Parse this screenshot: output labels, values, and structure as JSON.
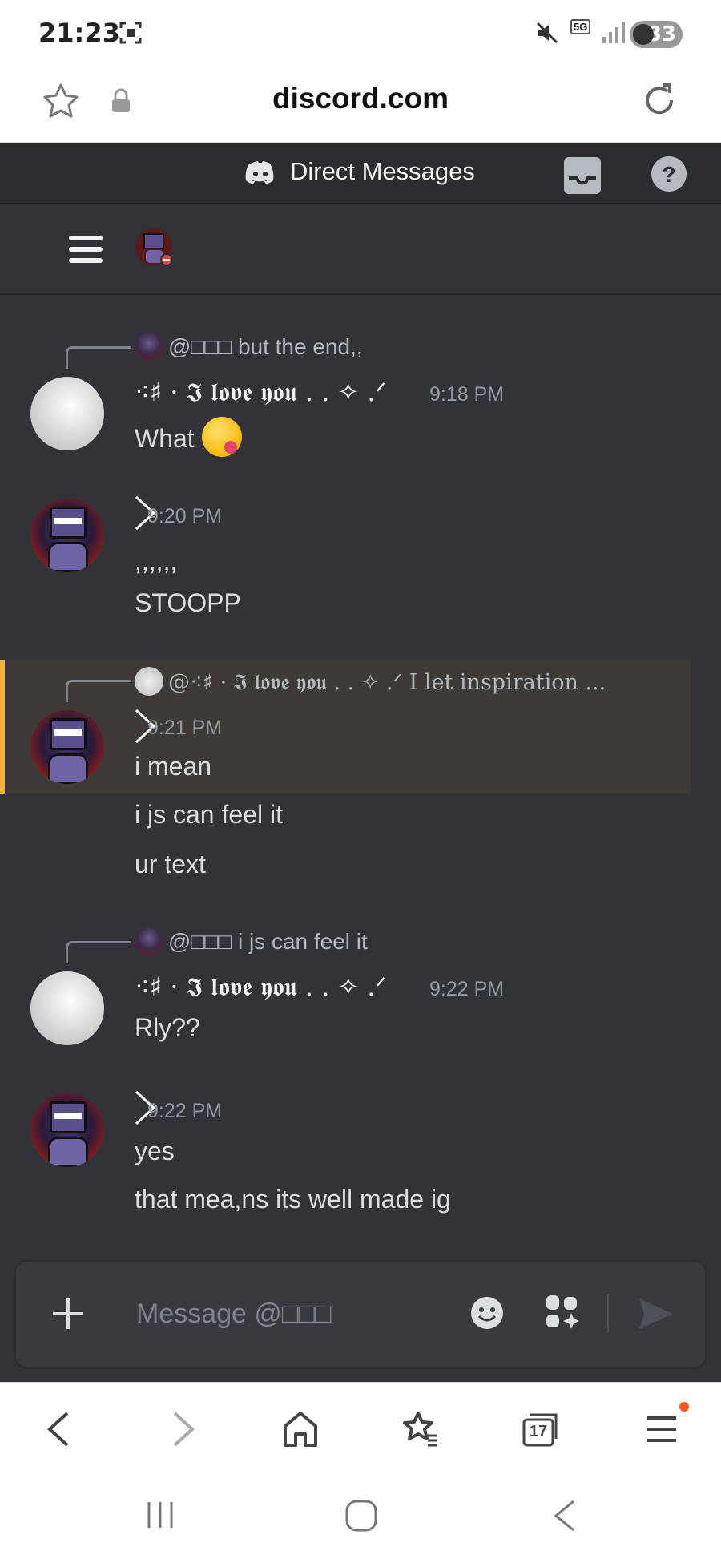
{
  "status": {
    "time": "21:23",
    "net": "5G",
    "battery": "33"
  },
  "browser": {
    "domain": "discord.com",
    "tab_count": "17"
  },
  "header": {
    "title": "Direct Messages"
  },
  "messages": [
    {
      "reply_to": "@□□□ but the end,,",
      "username": "⁖♯ · 𝕴 𝖑𝖔𝖛𝖊 𝖞𝖔𝖚 . . ✧ .ᐟ",
      "time": "9:18 PM",
      "lines": [
        "What"
      ]
    },
    {
      "time": "9:20 PM",
      "lines": [
        ",,,,,,",
        "STOOPP"
      ]
    },
    {
      "reply_to": "@⁖♯ · 𝕴 𝖑𝖔𝖛𝖊 𝖞𝖔𝖚 . . ✧ .ᐟ I let inspiration ...",
      "time": "9:21 PM",
      "lines": [
        "i mean",
        "i js can feel it",
        "ur text"
      ]
    },
    {
      "reply_to": "@□□□ i js can feel it",
      "username": "⁖♯ · 𝕴 𝖑𝖔𝖛𝖊 𝖞𝖔𝖚 . . ✧ .ᐟ",
      "time": "9:22 PM",
      "lines": [
        "Rly??"
      ]
    },
    {
      "time": "9:22 PM",
      "lines": [
        "yes",
        "that mea,ns its well made ig"
      ]
    }
  ],
  "composer": {
    "placeholder": "Message @□□□"
  },
  "colors": {
    "background": "#313338",
    "header": "#2b2d31",
    "highlight": "#3e3a35",
    "mention_bar": "#f0b232",
    "notification": "#ff5a1f"
  }
}
